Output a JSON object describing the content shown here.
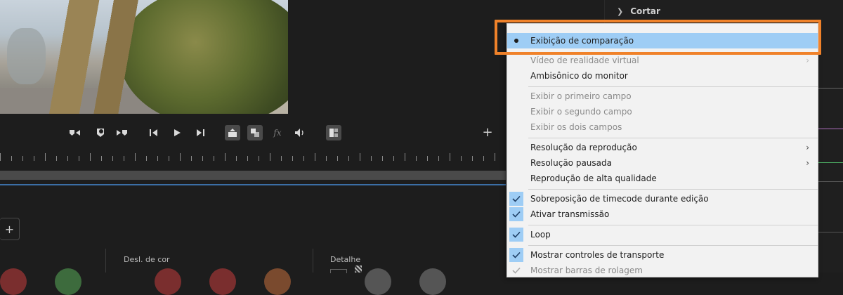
{
  "side_panel": {
    "section_label": "Cortar"
  },
  "program_monitor": {
    "transport_buttons": [
      {
        "name": "mark-in-button",
        "glyph": "⯈◂"
      },
      {
        "name": "add-marker-button",
        "glyph": "▼"
      },
      {
        "name": "mark-out-button",
        "glyph": "▸⯇"
      },
      {
        "name": "go-to-in-button",
        "glyph": "⇤"
      },
      {
        "name": "play-button",
        "glyph": "▶"
      },
      {
        "name": "go-to-out-button",
        "glyph": "⇥"
      },
      {
        "name": "lift-button",
        "glyph": "⇪"
      },
      {
        "name": "extract-button",
        "glyph": "⇲"
      },
      {
        "name": "fx-button",
        "glyph": "fx"
      },
      {
        "name": "audio-button",
        "glyph": "🔈"
      },
      {
        "name": "compare-view-button",
        "glyph": "▦"
      }
    ],
    "add_button": "+"
  },
  "lumetri": {
    "add_button": "+",
    "sections": [
      {
        "label": "Desl. de cor"
      },
      {
        "label": "Detalhe"
      }
    ]
  },
  "context_menu": {
    "groups": [
      [
        {
          "label": "Exibição de comparação",
          "state": "radio",
          "highlighted": true
        },
        {
          "label": "Vídeo de realidade virtual",
          "disabled": true,
          "submenu": true
        },
        {
          "label": "Ambisônico do monitor"
        }
      ],
      [
        {
          "label": "Exibir o primeiro campo",
          "disabled": true
        },
        {
          "label": "Exibir o segundo campo",
          "disabled": true
        },
        {
          "label": "Exibir os dois campos",
          "disabled": true
        }
      ],
      [
        {
          "label": "Resolução da reprodução",
          "submenu": true
        },
        {
          "label": "Resolução pausada",
          "submenu": true
        },
        {
          "label": "Reprodução de alta qualidade"
        }
      ],
      [
        {
          "label": "Sobreposição de timecode durante edição",
          "state": "check"
        },
        {
          "label": "Ativar transmissão",
          "state": "check"
        }
      ],
      [
        {
          "label": "Loop",
          "state": "check"
        }
      ],
      [
        {
          "label": "Mostrar controles de transporte",
          "state": "check"
        },
        {
          "label": "Mostrar barras de rolagem",
          "state": "check",
          "disabled": true
        }
      ]
    ]
  },
  "colors": {
    "highlight_outline": "#f0822a",
    "menu_selection": "#9ecdf5",
    "timeline_marker": "#3b6ea5"
  }
}
